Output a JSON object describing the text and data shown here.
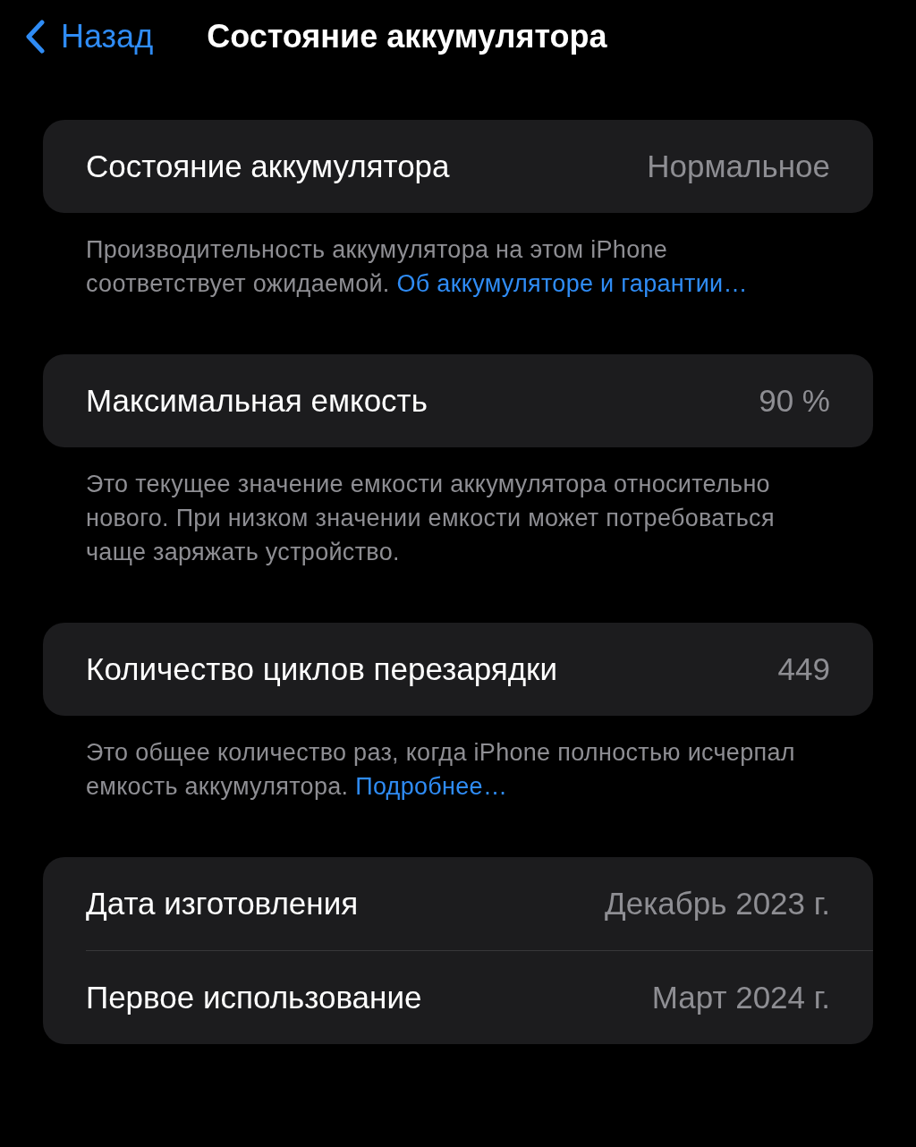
{
  "nav": {
    "back": "Назад",
    "title": "Состояние аккумулятора"
  },
  "sections": [
    {
      "rows": [
        {
          "label": "Состояние аккумулятора",
          "value": "Нормальное"
        }
      ],
      "footer": {
        "text": "Производительность аккумулятора на этом iPhone соответствует ожидаемой.",
        "link": "Об аккумуляторе и гарантии…"
      }
    },
    {
      "rows": [
        {
          "label": "Максимальная емкость",
          "value": "90 %"
        }
      ],
      "footer": {
        "text": "Это текущее значение емкости аккумулятора относительно нового. При низком значении емкости может потребоваться чаще заряжать устройство."
      }
    },
    {
      "rows": [
        {
          "label": "Количество циклов перезарядки",
          "value": "449"
        }
      ],
      "footer": {
        "text": "Это общее количество раз, когда iPhone полностью исчерпал емкость аккумулятора.",
        "link": "Подробнее…"
      }
    },
    {
      "rows": [
        {
          "label": "Дата изготовления",
          "value": "Декабрь 2023 г."
        },
        {
          "label": "Первое использование",
          "value": "Март 2024 г."
        }
      ]
    }
  ]
}
